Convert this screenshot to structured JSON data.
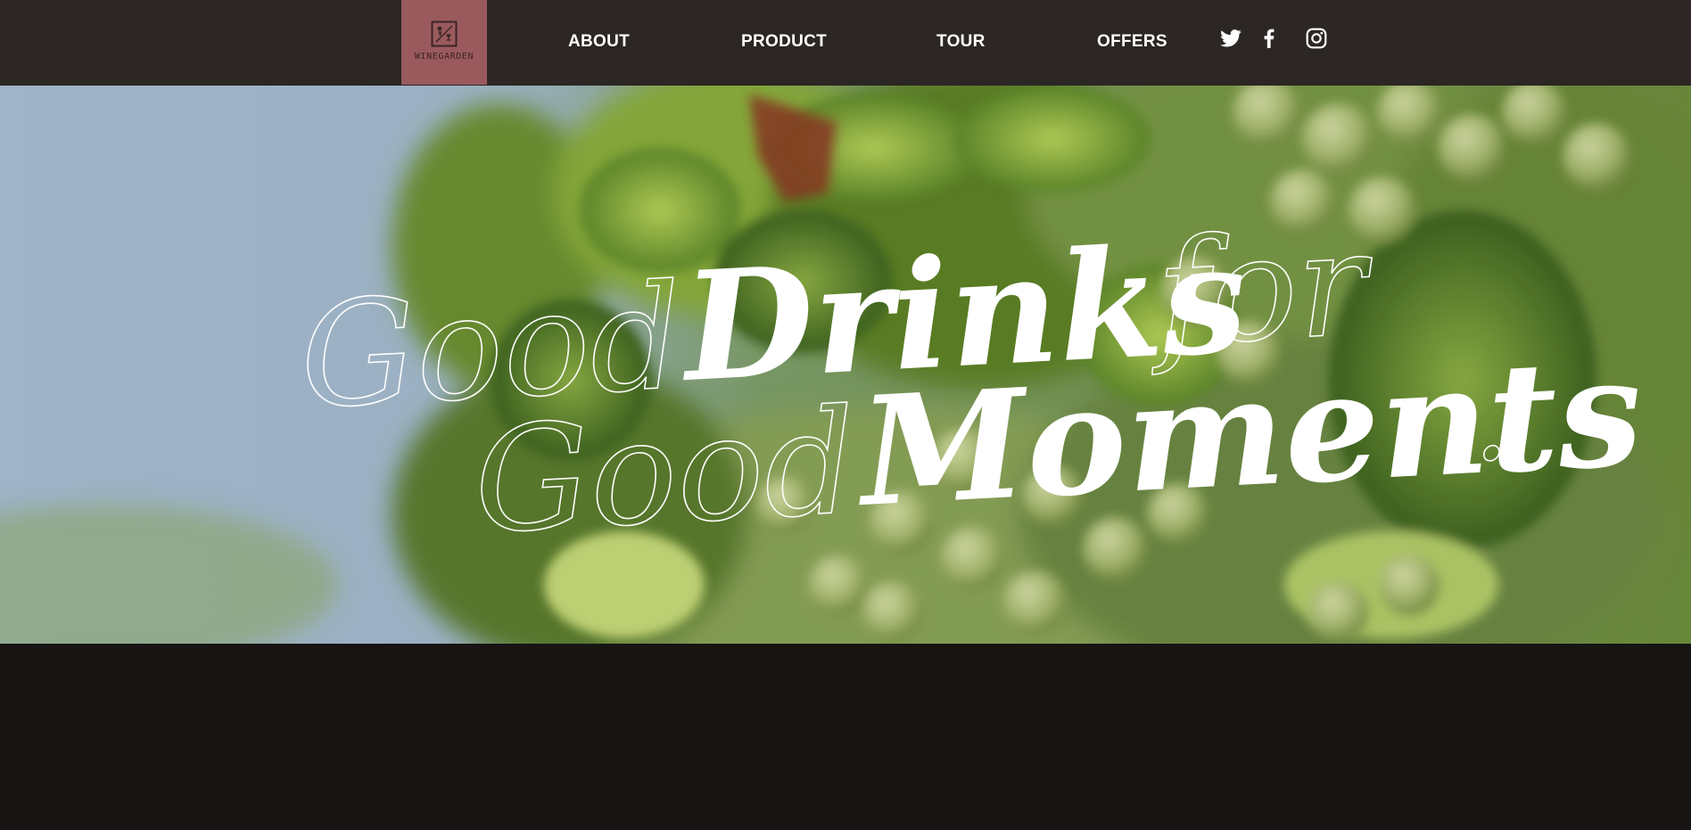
{
  "brand": {
    "name": "WINEGARDEN",
    "logo_color": "#9a5a5d"
  },
  "nav": {
    "items": [
      {
        "label": "ABOUT"
      },
      {
        "label": "PRODUCT"
      },
      {
        "label": "TOUR"
      },
      {
        "label": "OFFERS"
      }
    ],
    "social": [
      {
        "icon": "twitter-icon"
      },
      {
        "icon": "facebook-icon"
      },
      {
        "icon": "instagram-icon"
      }
    ]
  },
  "hero": {
    "line1": {
      "outline": "Good",
      "solid": "Drinks",
      "outline2": "for"
    },
    "line2": {
      "outline": "Good",
      "solid": "Moments",
      "dot": "."
    }
  },
  "colors": {
    "navbar": "#2c2624",
    "page": "#171413",
    "text": "#ffffff"
  }
}
